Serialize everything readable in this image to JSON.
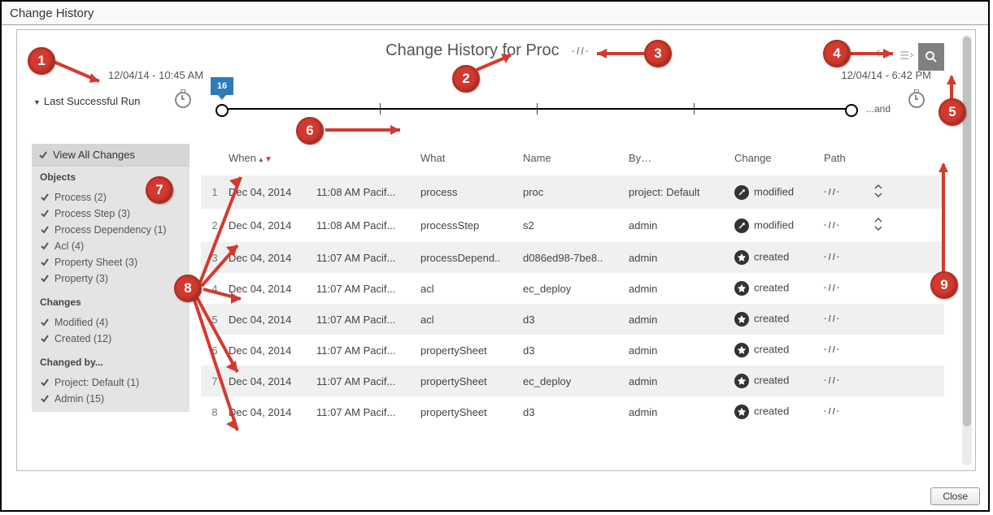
{
  "window": {
    "title": "Change History",
    "close": "Close"
  },
  "header": {
    "title": "Change History for Proc",
    "date_left": "12/04/14 - 10:45 AM",
    "date_right": "12/04/14 - 6:42 PM",
    "last_run": "Last Successful Run",
    "flag": "16",
    "and": "...and"
  },
  "sidebar": {
    "view_all": "View All Changes",
    "objects_hd": "Objects",
    "objects": [
      {
        "label": "Process (2)"
      },
      {
        "label": "Process Step (3)"
      },
      {
        "label": "Process Dependency (1)"
      },
      {
        "label": "Acl (4)"
      },
      {
        "label": "Property Sheet (3)"
      },
      {
        "label": "Property (3)"
      }
    ],
    "changes_hd": "Changes",
    "changes": [
      {
        "label": "Modified (4)"
      },
      {
        "label": "Created (12)"
      }
    ],
    "changedby_hd": "Changed by...",
    "changedby": [
      {
        "label": "Project: Default (1)"
      },
      {
        "label": "Admin (15)"
      }
    ]
  },
  "table": {
    "cols": {
      "when": "When",
      "what": "What",
      "name": "Name",
      "by": "By…",
      "change": "Change",
      "path": "Path"
    },
    "rows": [
      {
        "idx": "1",
        "date": "Dec 04, 2014",
        "time": "11:08 AM Pacif...",
        "what": "process",
        "name": "proc",
        "by": "project: Default",
        "ch": "modified",
        "icon": "mod",
        "path": "·//·",
        "exp": true
      },
      {
        "idx": "2",
        "date": "Dec 04, 2014",
        "time": "11:08 AM Pacif...",
        "what": "processStep",
        "name": "s2",
        "by": "admin",
        "ch": "modified",
        "icon": "mod",
        "path": "·//·",
        "exp": true
      },
      {
        "idx": "3",
        "date": "Dec 04, 2014",
        "time": "11:07 AM Pacif...",
        "what": "processDepend..",
        "name": "d086ed98-7be8..",
        "by": "admin",
        "ch": "created",
        "icon": "new",
        "path": "·//·",
        "exp": false
      },
      {
        "idx": "4",
        "date": "Dec 04, 2014",
        "time": "11:07 AM Pacif...",
        "what": "acl",
        "name": "ec_deploy",
        "by": "admin",
        "ch": "created",
        "icon": "new",
        "path": "·//·",
        "exp": false
      },
      {
        "idx": "5",
        "date": "Dec 04, 2014",
        "time": "11:07 AM Pacif...",
        "what": "acl",
        "name": "d3",
        "by": "admin",
        "ch": "created",
        "icon": "new",
        "path": "·//·",
        "exp": false
      },
      {
        "idx": "6",
        "date": "Dec 04, 2014",
        "time": "11:07 AM Pacif...",
        "what": "propertySheet",
        "name": "d3",
        "by": "admin",
        "ch": "created",
        "icon": "new",
        "path": "·//·",
        "exp": false
      },
      {
        "idx": "7",
        "date": "Dec 04, 2014",
        "time": "11:07 AM Pacif...",
        "what": "propertySheet",
        "name": "ec_deploy",
        "by": "admin",
        "ch": "created",
        "icon": "new",
        "path": "·//·",
        "exp": false
      },
      {
        "idx": "8",
        "date": "Dec 04, 2014",
        "time": "11:07 AM Pacif...",
        "what": "propertySheet",
        "name": "d3",
        "by": "admin",
        "ch": "created",
        "icon": "new",
        "path": "·//·",
        "exp": false
      }
    ]
  },
  "callouts": [
    "1",
    "2",
    "3",
    "4",
    "5",
    "6",
    "7",
    "8",
    "9"
  ]
}
